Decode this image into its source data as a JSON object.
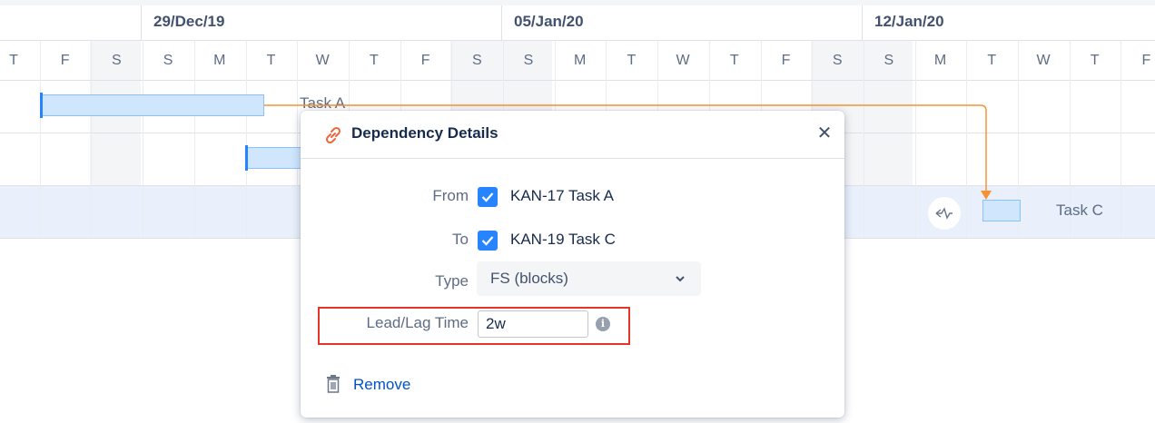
{
  "timeline": {
    "weeks": [
      "29/Dec/19",
      "05/Jan/20",
      "12/Jan/20"
    ],
    "days": [
      "T",
      "F",
      "S",
      "S",
      "M",
      "T",
      "W",
      "T",
      "F",
      "S",
      "S",
      "M",
      "T",
      "W",
      "T",
      "F",
      "S",
      "S",
      "M",
      "T",
      "W",
      "T",
      "F"
    ]
  },
  "tasks": [
    {
      "label": "Task A"
    },
    {
      "label": ""
    },
    {
      "label": "Task C"
    }
  ],
  "colors": {
    "bar_fill": "#cfe6fd",
    "bar_border": "#8cc2f7",
    "dependency_arrow": "#f79232",
    "accent": "#2684ff",
    "highlight_box": "#e63526",
    "link": "#0052cc"
  },
  "dialog": {
    "title": "Dependency Details",
    "icon": "link-icon",
    "from_label": "From",
    "from_value": "KAN-17 Task A",
    "from_checked": true,
    "to_label": "To",
    "to_value": "KAN-19 Task C",
    "to_checked": true,
    "type_label": "Type",
    "type_value": "FS (blocks)",
    "lag_label": "Lead/Lag Time",
    "lag_value": "2w",
    "remove_label": "Remove"
  }
}
